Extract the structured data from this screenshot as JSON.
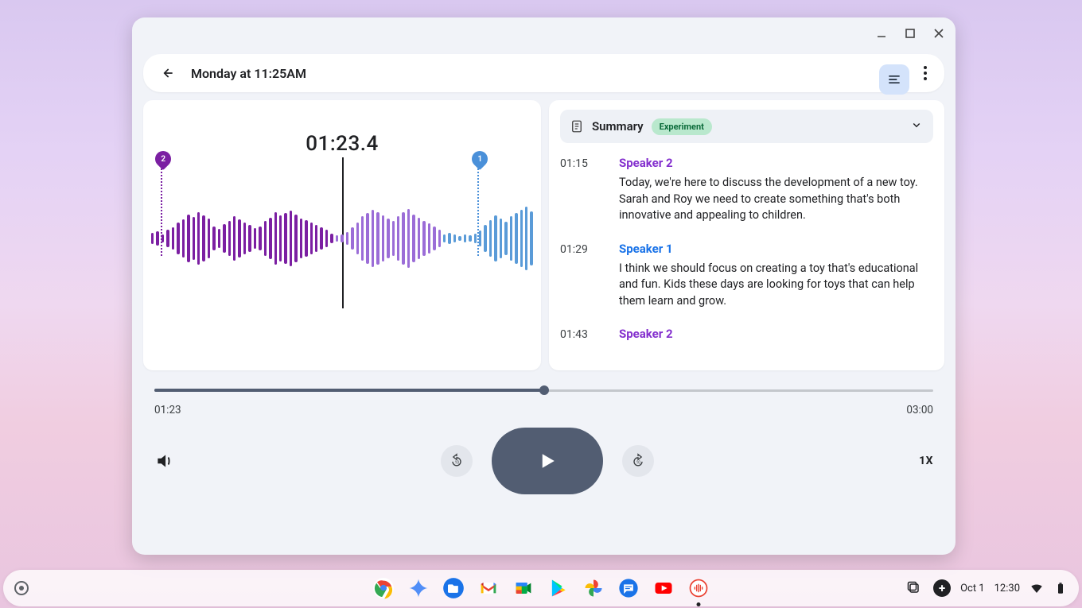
{
  "header": {
    "title": "Monday at 11:25AM"
  },
  "waveform": {
    "timecode": "01:23.4",
    "marker_left_label": "2",
    "marker_right_label": "1"
  },
  "summary": {
    "label": "Summary",
    "chip": "Experiment"
  },
  "speakers": {
    "s1": "Speaker 1",
    "s2": "Speaker 2"
  },
  "transcript": [
    {
      "ts": "01:15",
      "speaker": "s2",
      "text": "Today, we're here to discuss the development of a new toy. Sarah and Roy we need to create something that's both innovative and appealing to children."
    },
    {
      "ts": "01:29",
      "speaker": "s1",
      "text": "I think we should focus on creating a toy that's educational and fun. Kids these days are looking for toys that can help them learn and grow."
    },
    {
      "ts": "01:43",
      "speaker": "s2",
      "text": ""
    }
  ],
  "player": {
    "elapsed": "01:23",
    "total": "03:00",
    "progress_pct": 50,
    "speed": "1X"
  },
  "shelf": {
    "date": "Oct 1",
    "time": "12:30"
  }
}
